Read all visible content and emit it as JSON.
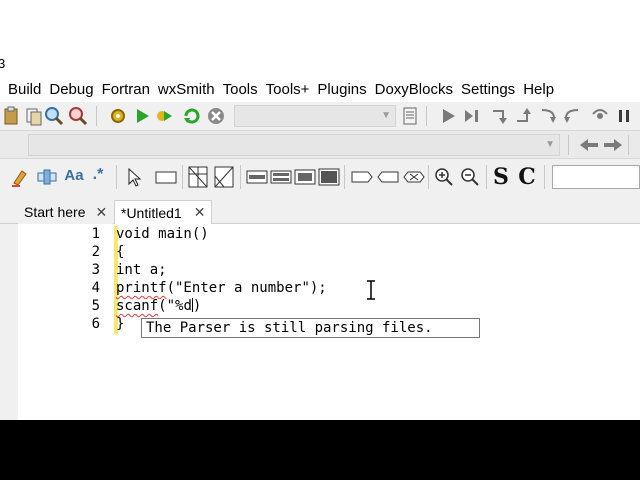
{
  "title_fragment": "3",
  "menu": [
    "Build",
    "Debug",
    "Fortran",
    "wxSmith",
    "Tools",
    "Tools+",
    "Plugins",
    "DoxyBlocks",
    "Settings",
    "Help"
  ],
  "toolbar1": {
    "icons": [
      "paste-icon",
      "copy-icon",
      "find-icon",
      "replace-icon",
      "build-icon",
      "run-icon",
      "build-run-icon",
      "rebuild-icon",
      "abort-icon",
      "log-icon",
      "debug-run-icon",
      "step-icon",
      "step-into-icon",
      "step-out-icon",
      "next-instruction-icon",
      "step-instruction-icon",
      "pause-icon"
    ]
  },
  "toolbar2": {
    "icons": [
      "jump-back-icon",
      "jump-forward-icon"
    ]
  },
  "toolbar3": {
    "icons": [
      "highlight-icon",
      "regex-icon",
      "match-case-icon",
      "wildcard-icon",
      "pointer-icon",
      "rectangle-icon",
      "grid-icon",
      "image-icon",
      "layout-1-icon",
      "layout-2-icon",
      "layout-3-icon",
      "layout-4-icon",
      "shape-1-icon",
      "shape-2-icon",
      "shape-3-icon",
      "zoom-in-icon",
      "zoom-out-icon"
    ],
    "s_label": "S",
    "c_label": "C",
    "aa_label": "Aa",
    "wild_label": ".*"
  },
  "tabs": [
    {
      "label": "Start here",
      "active": false
    },
    {
      "label": "*Untitled1",
      "active": true
    }
  ],
  "editor": {
    "line_numbers": [
      "1",
      "2",
      "3",
      "4",
      "5",
      "6"
    ],
    "lines": {
      "l1": "void main()",
      "l2": "{",
      "l3": "int a;",
      "l4_fn": "printf",
      "l4_rest": "(\"Enter a number\");",
      "l5_fn": "scanf",
      "l5_rest": "(\"%d",
      "l5_after": ")",
      "l6": "}"
    },
    "tooltip": "The Parser is still parsing files."
  },
  "colors": {
    "change_bar": "#f5e86a",
    "squiggle": "#e23b3b",
    "run_green": "#2aa52a",
    "abort_gray": "#8a8a8a"
  }
}
